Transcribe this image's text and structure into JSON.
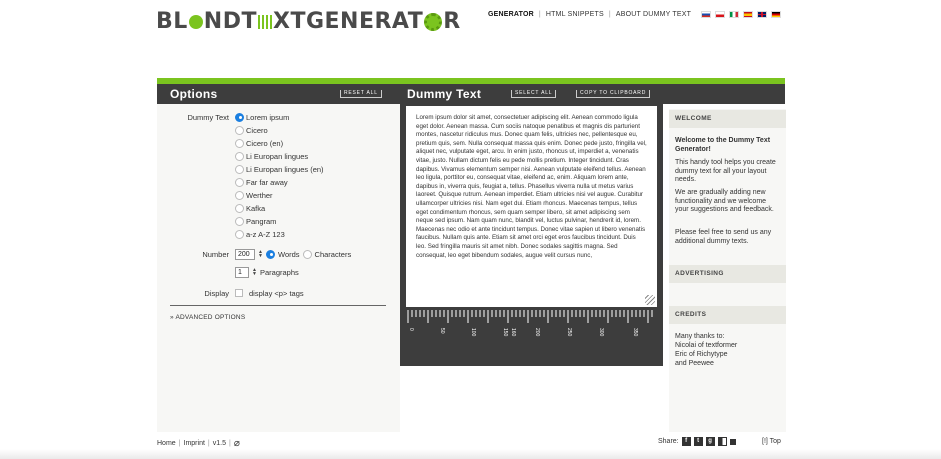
{
  "logo": {
    "part1": "BL",
    "part2": "NDT",
    "part3": "XTGENERAT",
    "part4": "R"
  },
  "nav": {
    "items": [
      "GENERATOR",
      "HTML SNIPPETS",
      "ABOUT DUMMY TEXT"
    ],
    "active": "GENERATOR"
  },
  "languages": [
    "ru",
    "cz",
    "it",
    "es",
    "uk",
    "de"
  ],
  "options": {
    "title": "Options",
    "reset_label": "RESET ALL",
    "dummy_text_label": "Dummy Text",
    "texts": [
      "Lorem ipsum",
      "Cicero",
      "Cicero (en)",
      "Li Europan lingues",
      "Li Europan lingues (en)",
      "Far far away",
      "Werther",
      "Kafka",
      "Pangram",
      "a-z A-Z 123"
    ],
    "selected_text": "Lorem ipsum",
    "number_label": "Number",
    "number_value": "200",
    "words_label": "Words",
    "characters_label": "Characters",
    "unit_selected": "Words",
    "paragraphs_value": "1",
    "paragraphs_label": "Paragraphs",
    "display_label": "Display",
    "display_p_label": "display <p> tags",
    "advanced_label": "» ADVANCED OPTIONS"
  },
  "dummy": {
    "title": "Dummy Text",
    "select_all_label": "SELECT ALL",
    "copy_label": "COPY TO CLIPBOARD",
    "text": "Lorem ipsum dolor sit amet, consectetuer adipiscing elit. Aenean commodo ligula eget dolor. Aenean massa. Cum sociis natoque penatibus et magnis dis parturient montes, nascetur ridiculus mus. Donec quam felis, ultricies nec, pellentesque eu, pretium quis, sem. Nulla consequat massa quis enim. Donec pede justo, fringilla vel, aliquet nec, vulputate eget, arcu. In enim justo, rhoncus ut, imperdiet a, venenatis vitae, justo. Nullam dictum felis eu pede mollis pretium. Integer tincidunt. Cras dapibus. Vivamus elementum semper nisi. Aenean vulputate eleifend tellus. Aenean leo ligula, porttitor eu, consequat vitae, eleifend ac, enim. Aliquam lorem ante, dapibus in, viverra quis, feugiat a, tellus. Phasellus viverra nulla ut metus varius laoreet. Quisque rutrum. Aenean imperdiet. Etiam ultricies nisi vel augue. Curabitur ullamcorper ultricies nisi. Nam eget dui. Etiam rhoncus. Maecenas tempus, tellus eget condimentum rhoncus, sem quam semper libero, sit amet adipiscing sem neque sed ipsum. Nam quam nunc, blandit vel, luctus pulvinar, hendrerit id, lorem. Maecenas nec odio et ante tincidunt tempus. Donec vitae sapien ut libero venenatis faucibus. Nullam quis ante. Etiam sit amet orci eget eros faucibus tincidunt. Duis leo. Sed fringilla mauris sit amet nibh. Donec sodales sagittis magna. Sed consequat, leo eget bibendum sodales, augue velit cursus nunc,",
    "ruler_labels": [
      "0",
      "50",
      "100",
      "150",
      "160",
      "200",
      "250",
      "300",
      "350"
    ]
  },
  "sidebar": {
    "welcome_head": "WELCOME",
    "welcome_title": "Welcome to the Dummy Text Generator!",
    "welcome_p1": "This handy tool helps you create dummy text for all your layout needs.",
    "welcome_p2": "We are gradually adding new functionality and we welcome your suggestions and feedback.",
    "welcome_p3": "Please feel free to send us any additional dummy texts.",
    "advertising_head": "ADVERTISING",
    "credits_head": "CREDITS",
    "credits_intro": "Many thanks to:",
    "credits_1": "Nicolai of textformer",
    "credits_2": "Eric of Richytype",
    "credits_3": "and Peewee"
  },
  "footer": {
    "home": "Home",
    "imprint": "Imprint",
    "version": "v1.5",
    "share_label": "Share:",
    "top_label": "[!] Top"
  },
  "colors": {
    "accent": "#7bc41f",
    "dark": "#3d3d3d",
    "radio": "#1b7fe0"
  }
}
